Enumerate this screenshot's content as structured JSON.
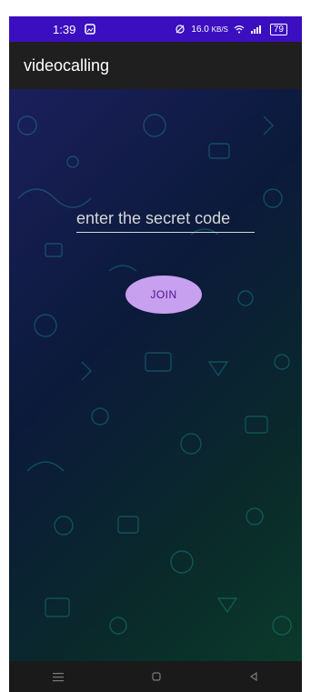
{
  "status_bar": {
    "time": "1:39",
    "notification_icon": "gallery-icon",
    "net_speed": "16.0",
    "net_unit": "KB/S",
    "battery": "79"
  },
  "app_bar": {
    "title": "videocalling"
  },
  "form": {
    "placeholder": "enter the secret code",
    "value": "",
    "join_label": "JOIN"
  },
  "colors": {
    "status_bar": "#3b0fbf",
    "app_bar": "#1f1f1f",
    "join_button": "#c8a0f0",
    "join_text": "#4a148c"
  },
  "nav_icons": [
    "menu-icon",
    "home-icon",
    "back-icon"
  ]
}
